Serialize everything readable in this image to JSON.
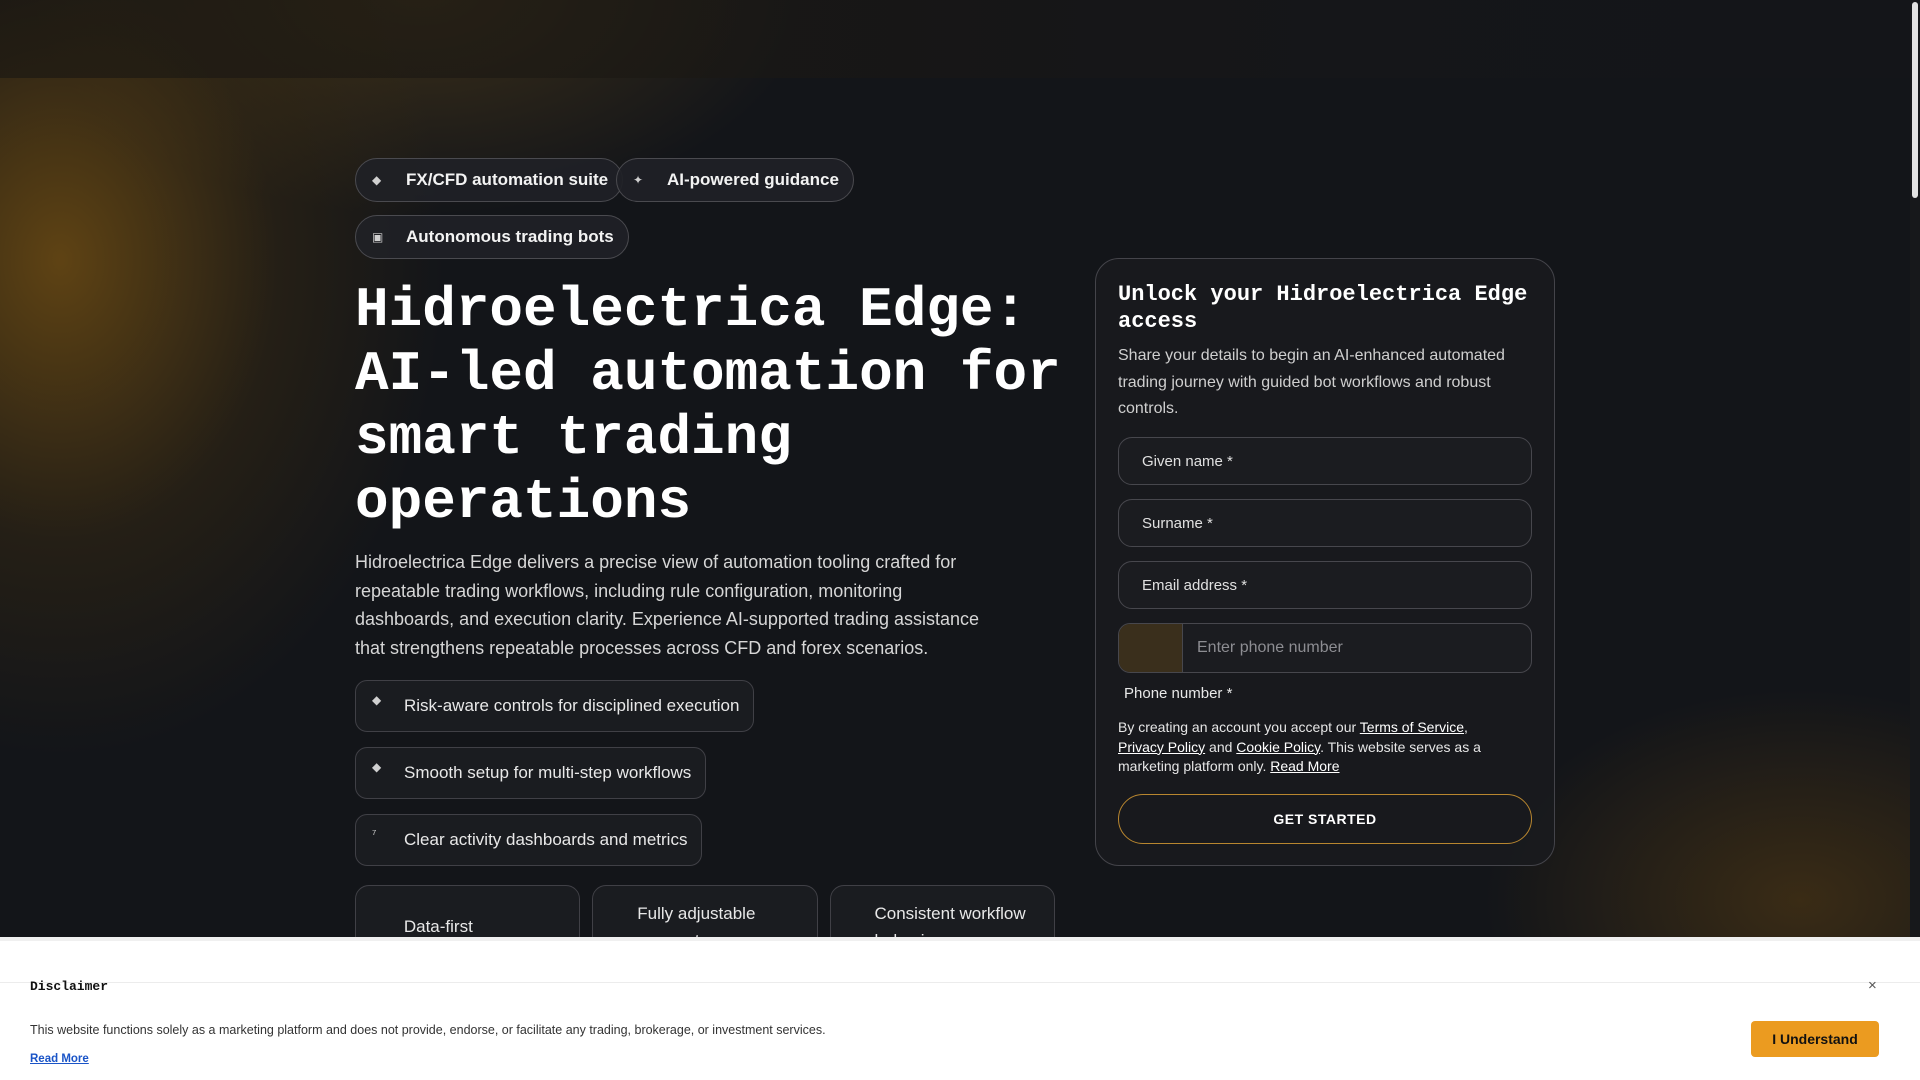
{
  "badges": [
    {
      "label": "FX/CFD automation suite",
      "icon": "chip-icon"
    },
    {
      "label": "AI-powered guidance",
      "icon": "sparkle-icon"
    },
    {
      "label": "Autonomous trading bots",
      "icon": "robot-icon"
    }
  ],
  "hero": {
    "title": "Hidroelectrica Edge: AI-led automation for smart trading operations",
    "description": "Hidroelectrica Edge delivers a precise view of automation tooling crafted for repeatable trading workflows, including rule configuration, monitoring dashboards, and execution clarity. Experience AI-supported trading assistance that strengthens repeatable processes across CFD and forex scenarios."
  },
  "features": [
    {
      "label": "Risk-aware controls for disciplined execution",
      "icon": "shield-icon"
    },
    {
      "label": "Smooth setup for multi-step workflows",
      "icon": "workflow-icon"
    },
    {
      "label": "Clear activity dashboards and metrics",
      "icon": "chart-icon"
    }
  ],
  "cards": [
    {
      "label": "Data-first governance",
      "icon": "database-icon"
    },
    {
      "label": "Fully adjustable parameters",
      "icon": "sliders-icon"
    },
    {
      "label": "Consistent workflow behavior",
      "icon": "repeat-icon"
    }
  ],
  "form": {
    "title": "Unlock your Hidroelectrica Edge access",
    "description": "Share your details to begin an AI-enhanced automated trading journey with guided bot workflows and robust controls.",
    "given_name_label": "Given name *",
    "surname_label": "Surname *",
    "email_label": "Email address *",
    "phone_placeholder": "Enter phone number",
    "phone_label": "Phone number *",
    "legal_prefix": "By creating an account you accept our ",
    "terms_link": "Terms of Service",
    "comma": ",",
    "privacy_link": "Privacy Policy",
    "and_text": " and ",
    "cookie_link": "Cookie Policy",
    "legal_suffix": ". This website serves as a marketing platform only. ",
    "read_more_link": "Read More",
    "cta_label": "GET STARTED"
  },
  "disclaimer": {
    "title": "Disclaimer",
    "close_icon": "×",
    "text": "This website functions solely as a marketing platform and does not provide, endorse, or facilitate any trading, brokerage, or investment services.",
    "read_more": "Read More",
    "button_label": "I Understand"
  },
  "colors": {
    "accent": "#eb9b20",
    "cta_border": "#b8862f",
    "background": "#131519"
  }
}
